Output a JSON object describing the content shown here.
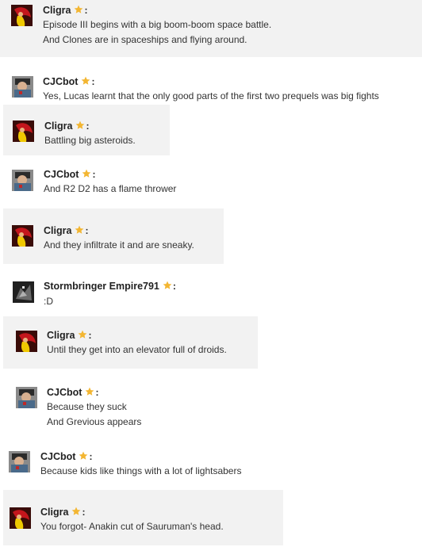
{
  "colors": {
    "shade": "#f2f2f2",
    "star": "#f3b632"
  },
  "icons": {
    "rank": "star-icon"
  },
  "messages": [
    {
      "user": "Cligra",
      "avatar": "cligra-avatar",
      "colon": ":",
      "shaded": true,
      "lines": [
        "Episode III begins with a big boom-boom space battle.",
        "And Clones are in spaceships and flying around."
      ]
    },
    {
      "user": "CJCbot",
      "avatar": "cjcbot-avatar",
      "colon": ":",
      "shaded": false,
      "lines": [
        "Yes, Lucas learnt that the only good parts of the first two prequels was big fights"
      ]
    },
    {
      "user": "Cligra",
      "avatar": "cligra-avatar",
      "colon": ":",
      "shaded": true,
      "lines": [
        "Battling big asteroids."
      ]
    },
    {
      "user": "CJCbot",
      "avatar": "cjcbot-avatar",
      "colon": ":",
      "shaded": false,
      "lines": [
        "And R2 D2 has a flame thrower"
      ]
    },
    {
      "user": "Cligra",
      "avatar": "cligra-avatar",
      "colon": ":",
      "shaded": true,
      "lines": [
        "And they infiltrate it and are sneaky."
      ]
    },
    {
      "user": "Stormbringer Empire791",
      "avatar": "stormbringer-avatar",
      "colon": ":",
      "shaded": false,
      "lines": [
        ":D"
      ]
    },
    {
      "user": "Cligra",
      "avatar": "cligra-avatar",
      "colon": ":",
      "shaded": true,
      "lines": [
        "Until they get into an elevator full of droids."
      ]
    },
    {
      "user": "CJCbot",
      "avatar": "cjcbot-avatar",
      "colon": ":",
      "shaded": false,
      "lines": [
        "Because they suck",
        "And Grevious appears"
      ]
    },
    {
      "user": "CJCbot",
      "avatar": "cjcbot-avatar",
      "colon": ":",
      "shaded": false,
      "lines": [
        "Because kids like things with a lot of lightsabers"
      ]
    },
    {
      "user": "Cligra",
      "avatar": "cligra-avatar",
      "colon": ":",
      "shaded": true,
      "lines": [
        "You forgot- Anakin cut of Sauruman's head."
      ]
    }
  ]
}
